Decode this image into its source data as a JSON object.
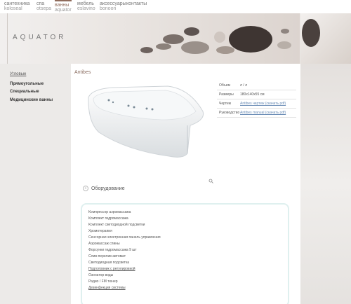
{
  "nav": {
    "items": [
      {
        "l1": "сантехника",
        "l2": "koloseal"
      },
      {
        "l1": "спа",
        "l2": "otsepa"
      },
      {
        "l1": "ванны",
        "l2": "aquator"
      },
      {
        "l1": "мебель",
        "l2": "eslavino"
      },
      {
        "l1": "аксессуары",
        "l2": "bonoon"
      },
      {
        "l1": "контакты",
        "l2": ""
      }
    ]
  },
  "logo": "AQUATOR",
  "sidebar": {
    "items": [
      "Угловые",
      "Прямоугольные",
      "Специальные",
      "Медицинские ванны"
    ]
  },
  "product": {
    "title": "Antibes",
    "specs": [
      {
        "k": "Объем",
        "v": "л / л",
        "link": false
      },
      {
        "k": "Размеры",
        "v": "180x140x55 см",
        "link": false
      },
      {
        "k": "Чертеж",
        "v": "Antibes чертеж (скачать pdf)",
        "link": true
      },
      {
        "k": "Руководство",
        "v": "Antibes manual (скачать pdf)",
        "link": true
      }
    ]
  },
  "equipment": {
    "header": "Оборудование",
    "items": [
      {
        "text": "Компрессор аэромассажа",
        "ul": false
      },
      {
        "text": "Комплект гидромассажа",
        "ul": false
      },
      {
        "text": "Комплект светодиодной подсветки",
        "ul": false
      },
      {
        "text": "Хромотерапия",
        "ul": false
      },
      {
        "text": "Сенсорная электронная панель управления",
        "ul": false
      },
      {
        "text": "Аэромассаж спины",
        "ul": false
      },
      {
        "text": "Форсунки гидромассажа 9 шт",
        "ul": false
      },
      {
        "text": "Слив-перелив автомат",
        "ul": false
      },
      {
        "text": "Светодиодная подсветка",
        "ul": false
      },
      {
        "text": "Подголовник с регулировкой",
        "ul": true
      },
      {
        "text": "Озонатор воды",
        "ul": false
      },
      {
        "text": "Радио / FM тюнер",
        "ul": false
      },
      {
        "text": "Дезинфекция системы",
        "ul": true
      }
    ]
  },
  "colors": {
    "accent": "#8f6b5b",
    "link": "#6a8cb5"
  }
}
